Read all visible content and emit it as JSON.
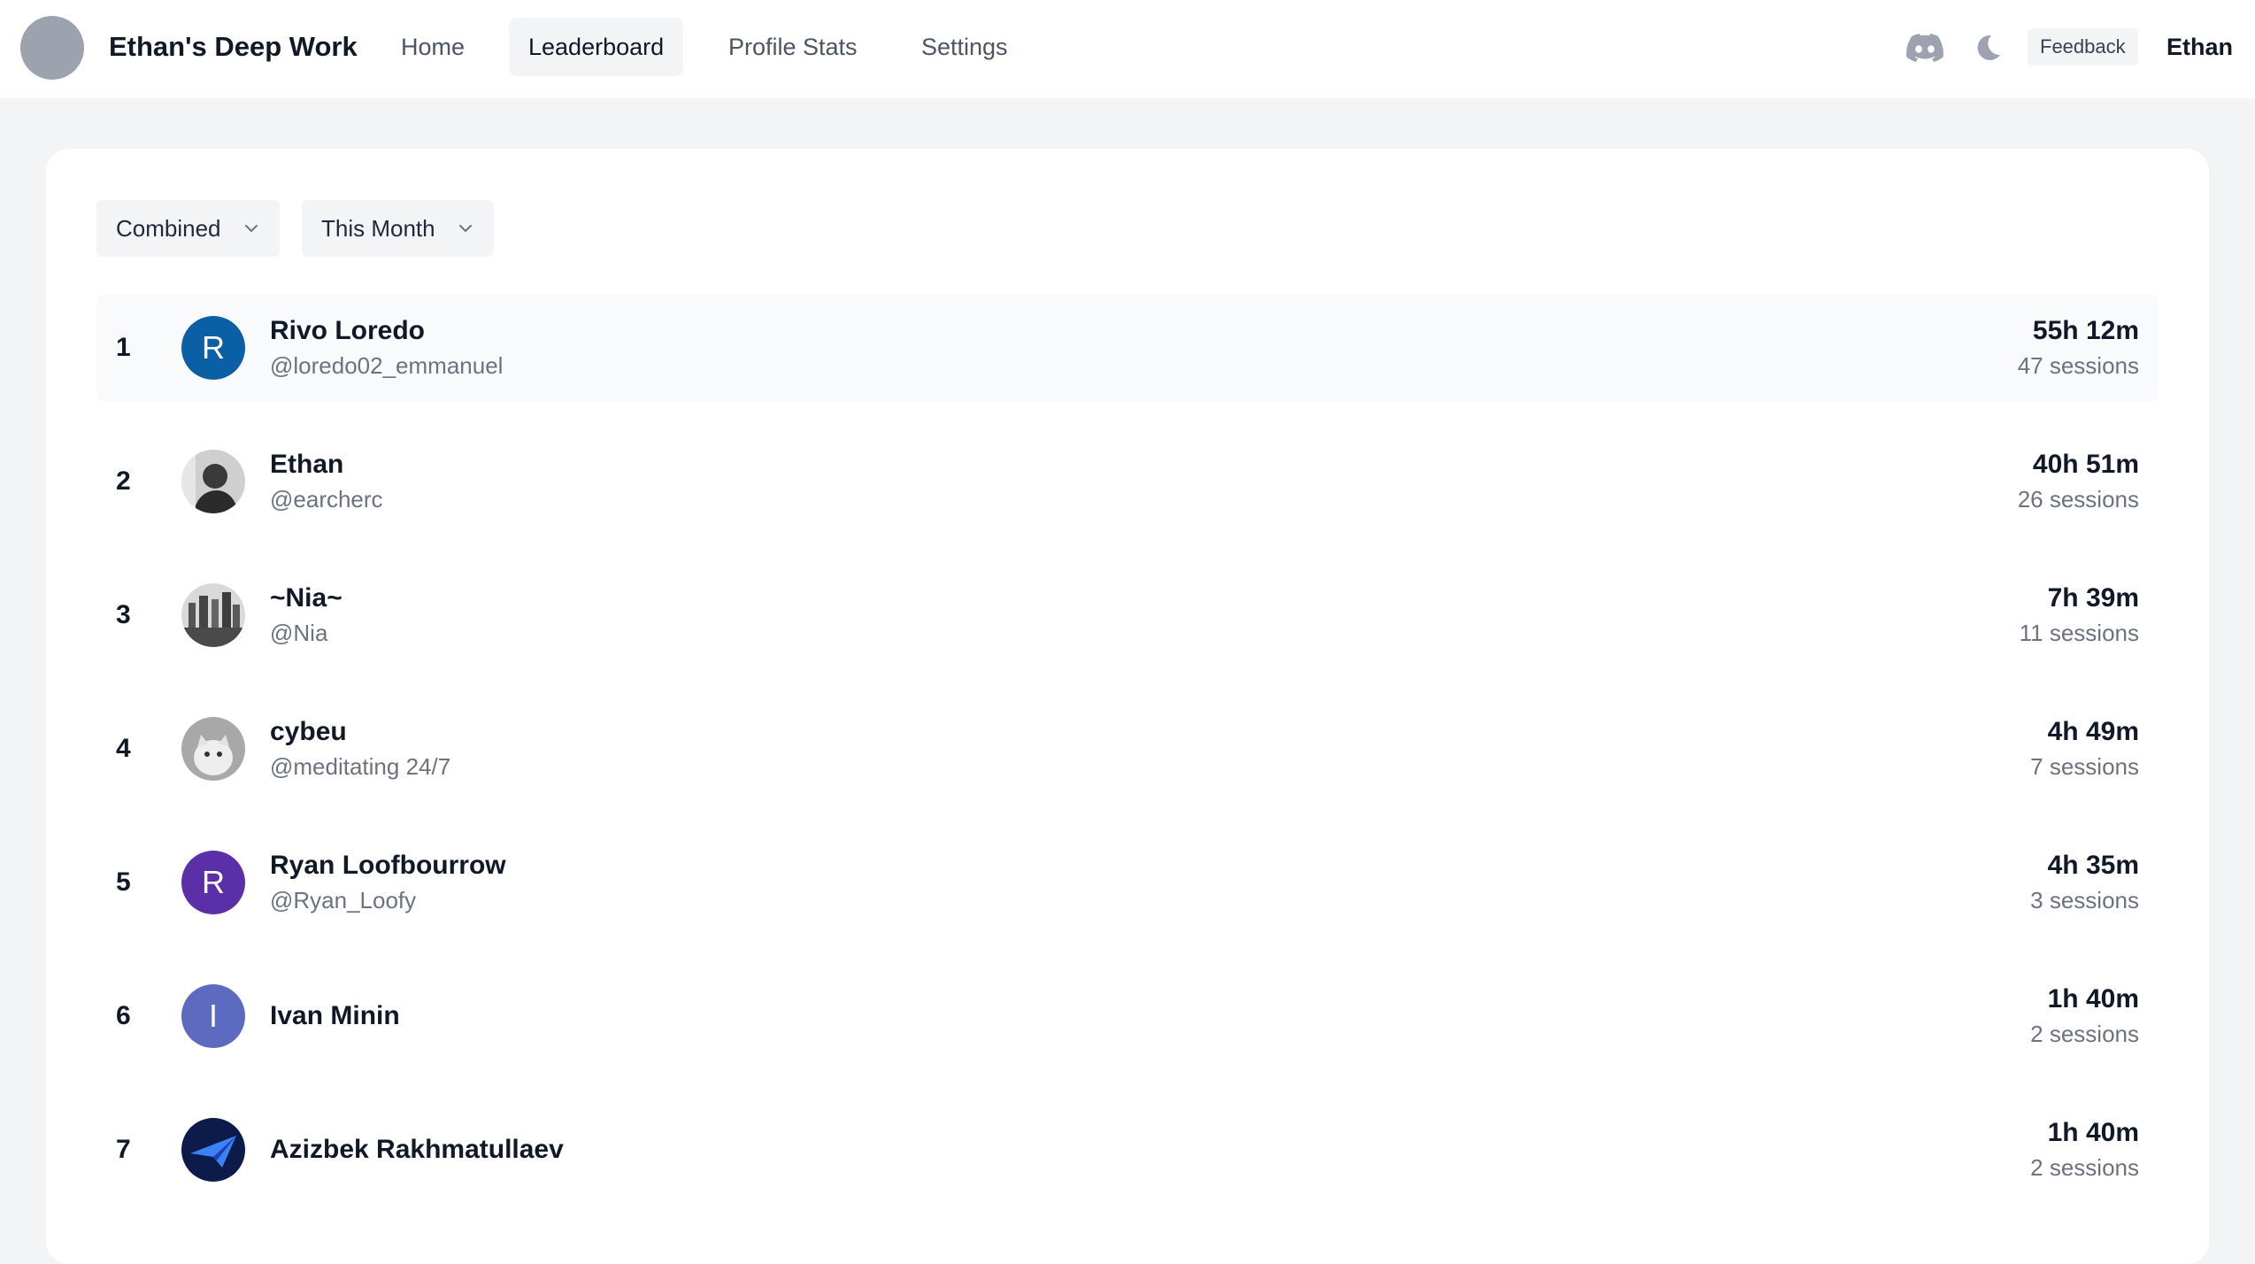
{
  "header": {
    "title": "Ethan's Deep Work",
    "nav": [
      {
        "label": "Home",
        "active": false
      },
      {
        "label": "Leaderboard",
        "active": true
      },
      {
        "label": "Profile Stats",
        "active": false
      },
      {
        "label": "Settings",
        "active": false
      }
    ],
    "icons": [
      "discord-icon",
      "moon-icon"
    ],
    "feedback_label": "Feedback",
    "user_name": "Ethan"
  },
  "filters": {
    "mode": {
      "selected": "Combined"
    },
    "period": {
      "selected": "This Month"
    }
  },
  "leaderboard": [
    {
      "rank": "1",
      "name": "Rivo Loredo",
      "handle": "@loredo02_emmanuel",
      "time": "55h 12m",
      "sessions": "47 sessions",
      "avatar_letter": "R",
      "avatar_color": "#0b5fa5"
    },
    {
      "rank": "2",
      "name": "Ethan",
      "handle": "@earcherc",
      "time": "40h 51m",
      "sessions": "26 sessions",
      "avatar_letter": "",
      "avatar_color": "#6b6b6b"
    },
    {
      "rank": "3",
      "name": "~Nia~",
      "handle": "@Nia",
      "time": "7h 39m",
      "sessions": "11 sessions",
      "avatar_letter": "",
      "avatar_color": "#7a7a7a"
    },
    {
      "rank": "4",
      "name": "cybeu",
      "handle": "@meditating 24/7",
      "time": "4h 49m",
      "sessions": "7 sessions",
      "avatar_letter": "",
      "avatar_color": "#9a9a9a"
    },
    {
      "rank": "5",
      "name": "Ryan Loofbourrow",
      "handle": "@Ryan_Loofy",
      "time": "4h 35m",
      "sessions": "3 sessions",
      "avatar_letter": "R",
      "avatar_color": "#5b2fa8"
    },
    {
      "rank": "6",
      "name": "Ivan Minin",
      "handle": "",
      "time": "1h 40m",
      "sessions": "2 sessions",
      "avatar_letter": "I",
      "avatar_color": "#5c6bc0"
    },
    {
      "rank": "7",
      "name": "Azizbek Rakhmatullaev",
      "handle": "",
      "time": "1h 40m",
      "sessions": "2 sessions",
      "avatar_letter": "",
      "avatar_color": "#0d1b4a"
    }
  ]
}
